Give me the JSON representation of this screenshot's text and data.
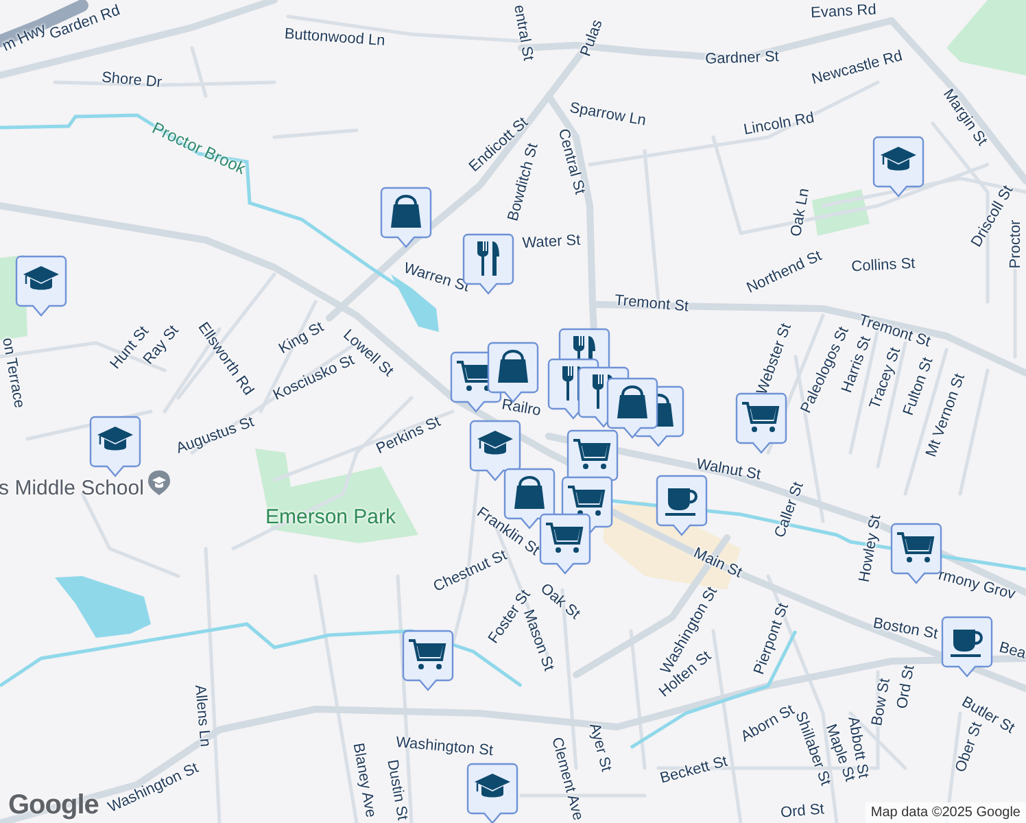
{
  "map": {
    "street_labels": [
      "m Hwy",
      "Garden Rd",
      "Buttonwood Ln",
      "Shore Dr",
      "entral St",
      "Pulas",
      "Evans Rd",
      "Gardner St",
      "Newcastle Rd",
      "Sparrow Ln",
      "Lincoln Rd",
      "Margin St",
      "Endicott St",
      "Bowditch St",
      "Central St",
      "Water St",
      "Warren St",
      "Tremont St",
      "Northend St",
      "Collins St",
      "Oak Ln",
      "Driscoll St",
      "Proctor",
      "Tremont St",
      "Webster St",
      "Paleologos St",
      "Harris St",
      "Tracey St",
      "Fulton St",
      "Mt Vernon St",
      "Lowell St",
      "King St",
      "Kosciusko St",
      "Ellsworth Rd",
      "Ray St",
      "Hunt St",
      "on Terrace",
      "Augustus St",
      "Perkins St",
      "Railro",
      "Franklin St",
      "Chestnut St",
      "Foster St",
      "Oak St",
      "Mason St",
      "Washington St",
      "Main St",
      "Walnut St",
      "Caller St",
      "Howley St",
      "rmony Grov",
      "Boston St",
      "Bea",
      "Pierpont St",
      "Holten St",
      "Aborn St",
      "Shillaber St",
      "Maple St",
      "Abbott St",
      "Bow St",
      "Ord St",
      "Butler St",
      "Ober St",
      "Ayer St",
      "Clement Ave",
      "Beckett St",
      "Washington St",
      "Washington St",
      "Allens Ln",
      "Blaney Ave",
      "Dustin St",
      "Ord St"
    ],
    "area_labels": [
      {
        "text": "Proctor Brook",
        "kind": "water"
      },
      {
        "text": "Emerson Park",
        "kind": "park"
      },
      {
        "text": "s Middle School",
        "kind": "place"
      }
    ],
    "pins": [
      {
        "kind": "school"
      },
      {
        "kind": "shopping"
      },
      {
        "kind": "restaurant"
      },
      {
        "kind": "school"
      },
      {
        "kind": "grocery"
      },
      {
        "kind": "shopping"
      },
      {
        "kind": "school"
      },
      {
        "kind": "school"
      },
      {
        "kind": "grocery"
      },
      {
        "kind": "cafe"
      },
      {
        "kind": "grocery"
      },
      {
        "kind": "cafe"
      },
      {
        "kind": "grocery"
      },
      {
        "kind": "school"
      },
      {
        "kind": "restaurant"
      },
      {
        "kind": "restaurant"
      },
      {
        "kind": "restaurant"
      },
      {
        "kind": "shopping"
      },
      {
        "kind": "shopping"
      },
      {
        "kind": "grocery"
      },
      {
        "kind": "shopping"
      },
      {
        "kind": "grocery"
      },
      {
        "kind": "grocery"
      }
    ],
    "logo": "Google",
    "attribution": "Map data ©2025 Google"
  }
}
